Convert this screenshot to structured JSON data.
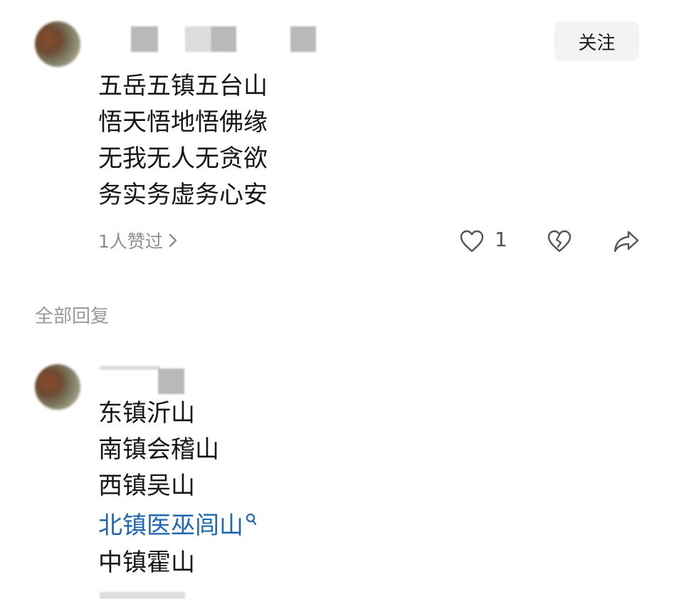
{
  "comment": {
    "follow_label": "关注",
    "lines": [
      "五岳五镇五台山",
      "悟天悟地悟佛缘",
      "无我无人无贪欲",
      "务实务虚务心安"
    ],
    "likes_summary": "1人赞过",
    "like_count": "1"
  },
  "replies_header": "全部回复",
  "reply": {
    "lines": [
      "东镇沂山",
      "南镇会稽山",
      "西镇吴山"
    ],
    "link_line": "北镇医巫闾山",
    "last_line": "中镇霍山"
  },
  "colors": {
    "link": "#1f67b0",
    "muted": "#8c8c8c",
    "follow_bg": "#f3f3f3"
  },
  "icons": [
    "chevron-right-icon",
    "heart-icon",
    "broken-heart-icon",
    "share-icon",
    "search-icon"
  ]
}
